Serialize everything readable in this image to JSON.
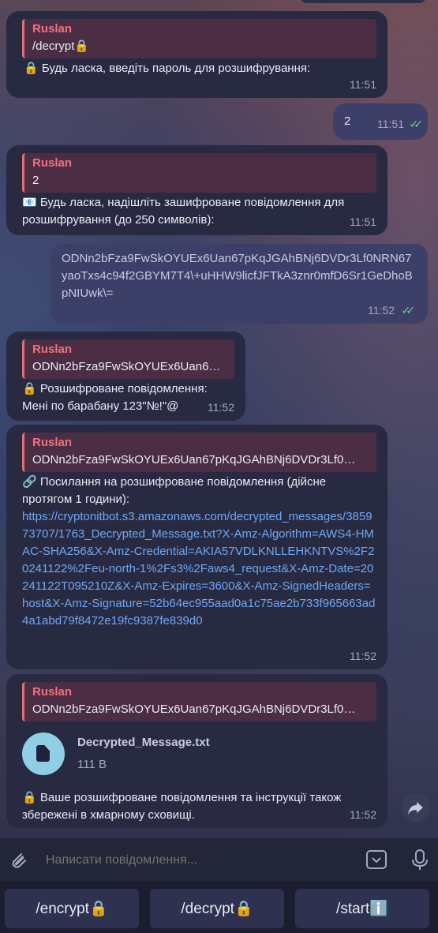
{
  "messages": [
    {
      "reply_name": "Ruslan",
      "reply_text": "/decrypt🔒",
      "text": "🔒 Будь ласка, введіть пароль для розшифрування:",
      "time": "11:51"
    },
    {
      "text": "2",
      "time": "11:51"
    },
    {
      "reply_name": "Ruslan",
      "reply_text": "2",
      "text": "📧 Будь ласка, надішліть зашифроване повідомлення для розшифрування (до 250 символів):",
      "time": "11:51"
    },
    {
      "text": "ODNn2bFza9FwSkOYUEx6Uan67pKqJGAhBNj6DVDr3Lf0NRN67yaoTxs4c94f2GBYM7T4\\+uHHW9licfJFTkA3znr0mfD6Sr1GeDhoBpNIUwk\\=",
      "time": "11:52"
    },
    {
      "reply_name": "Ruslan",
      "reply_text": "ODNn2bFza9FwSkOYUEx6Uan6…",
      "text_a": "🔒 Розшифроване повідомлення:",
      "text_b": "Мені по барабану 123\"№!\"@",
      "time": "11:52"
    },
    {
      "reply_name": "Ruslan",
      "reply_text": "ODNn2bFza9FwSkOYUEx6Uan67pKqJGAhBNj6DVDr3Lf0…",
      "text": "🔗 Посилання на розшифроване повідомлення (дійсне протягом 1 години):",
      "link": "https://cryptonitbot.s3.amazonaws.com/decrypted_messages/385973707/1763_Decrypted_Message.txt?X-Amz-Algorithm=AWS4-HMAC-SHA256&X-Amz-Credential=AKIA57VDLKNLLEHKNTVS%2F20241122%2Feu-north-1%2Fs3%2Faws4_request&X-Amz-Date=20241122T095210Z&X-Amz-Expires=3600&X-Amz-SignedHeaders=host&X-Amz-Signature=52b64ec955aad0a1c75ae2b733f965663ad4a1abd79f8472e19fc9387fe839d0",
      "time": "11:52"
    },
    {
      "reply_name": "Ruslan",
      "reply_text": "ODNn2bFza9FwSkOYUEx6Uan67pKqJGAhBNj6DVDr3Lf0…",
      "file_name": "Decrypted_Message.txt",
      "file_size": "111 B",
      "text": "🔒 Ваше розшифроване повідомлення та інструкції також збережені в хмарному сховищі.",
      "time": "11:52"
    }
  ],
  "input": {
    "placeholder": "Написати повідомлення..."
  },
  "keyboard": [
    "/encrypt🔒",
    "/decrypt🔒",
    "/startℹ️"
  ],
  "colors": {
    "accent": "#6ea8f5",
    "reply_name": "#f0717d",
    "read_ticks": "#6fd08c"
  }
}
